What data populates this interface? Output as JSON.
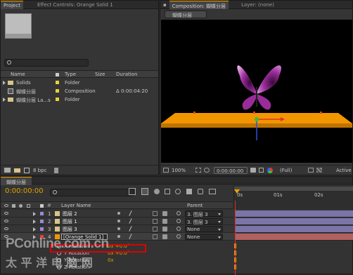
{
  "project_panel": {
    "tabs": [
      "Project",
      "Effect Controls: Orange Solid 1"
    ],
    "search_placeholder": "",
    "columns": [
      "Name",
      "Type",
      "Size",
      "Duration"
    ],
    "items": [
      {
        "name": "Solids",
        "type": "Folder",
        "duration": ""
      },
      {
        "name": "蝴蝶分层",
        "type": "Composition",
        "duration": "Δ 0:00:04:20"
      },
      {
        "name": "蝴蝶分层 La...s",
        "type": "Folder",
        "duration": ""
      }
    ],
    "bpc": "8 bpc"
  },
  "composition_panel": {
    "tabs": [
      "Composition: 蝴蝶分层",
      "Layer: (none)"
    ],
    "comp_label": "蝴蝶分层",
    "zoom": "100%",
    "timecode": "0:00:00:00",
    "resolution": "(Full)",
    "camera": "Active"
  },
  "timeline_panel": {
    "tab": "蝴蝶分层",
    "timecode": "0:00:00:00",
    "header_layer_name": "Layer Name",
    "header_parent": "Parent",
    "ruler": [
      "0s",
      "01s",
      "02s"
    ],
    "layers": [
      {
        "num": "1",
        "name": "图层 2",
        "parent": "3. 图层 3"
      },
      {
        "num": "2",
        "name": "图层 1",
        "parent": "3. 图层 3"
      },
      {
        "num": "3",
        "name": "图层 3",
        "parent": "None"
      },
      {
        "num": "4",
        "name": "[Orange Solid 1]",
        "parent": "None"
      }
    ],
    "properties": [
      {
        "name": "X Rotation",
        "value": "0x +0.0°"
      },
      {
        "name": "Y Rotation",
        "value": "0x +0.0°"
      },
      {
        "name": "Y Rotation",
        "value": "0x"
      },
      {
        "name": "Z Rotation",
        "value": ""
      }
    ]
  },
  "watermark": {
    "line1": "PConline.com.cn",
    "line2": "太 平 洋 电 脑 网"
  },
  "colors": {
    "accent": "#f0a000",
    "solid": "#f29600",
    "butterfly": "#c040c0",
    "red_highlight": "#e00000"
  }
}
